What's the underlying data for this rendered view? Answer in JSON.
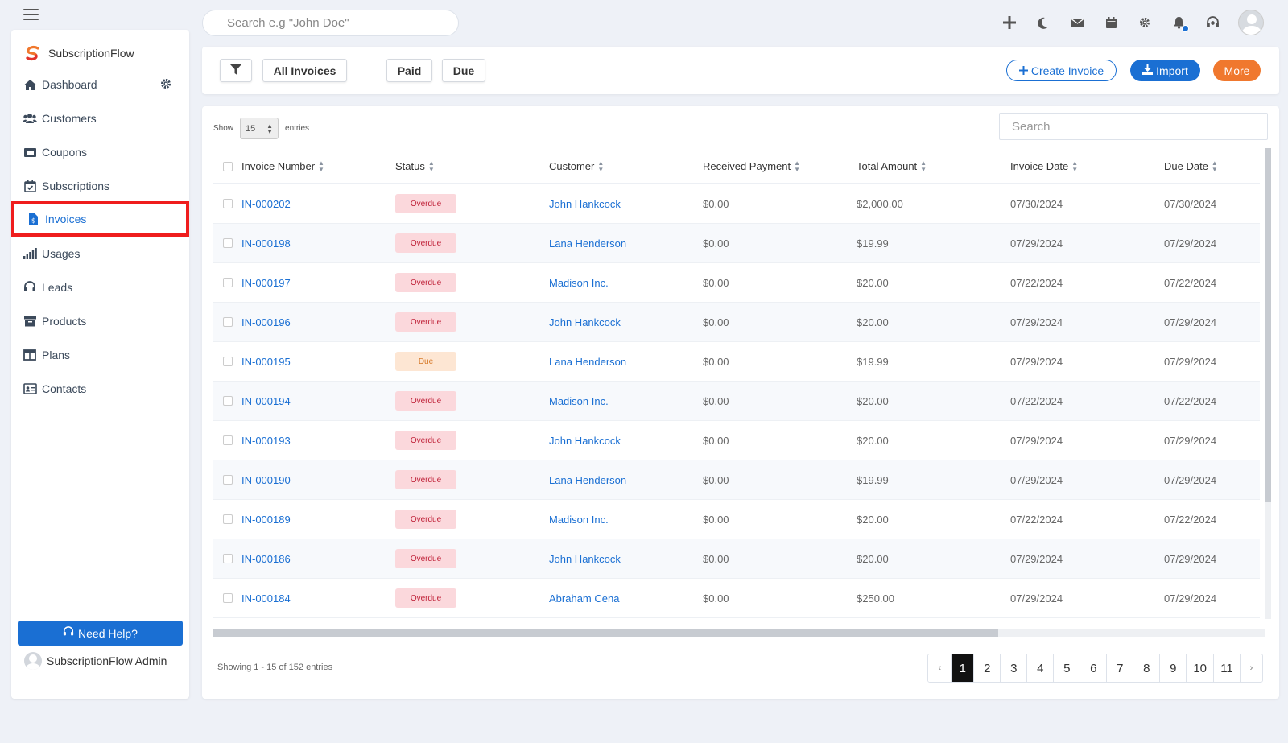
{
  "topbar": {
    "search_placeholder": "Search e.g \"John Doe\""
  },
  "sidebar": {
    "brand": "SubscriptionFlow",
    "items": [
      {
        "label": "Dashboard",
        "icon": "home-icon"
      },
      {
        "label": "Customers",
        "icon": "users-icon"
      },
      {
        "label": "Coupons",
        "icon": "ticket-icon"
      },
      {
        "label": "Subscriptions",
        "icon": "calendar-check-icon"
      },
      {
        "label": "Invoices",
        "icon": "file-invoice-icon"
      },
      {
        "label": "Usages",
        "icon": "signal-bars-icon"
      },
      {
        "label": "Leads",
        "icon": "headset-icon"
      },
      {
        "label": "Products",
        "icon": "archive-box-icon"
      },
      {
        "label": "Plans",
        "icon": "columns-icon"
      },
      {
        "label": "Contacts",
        "icon": "address-card-icon"
      }
    ],
    "help_label": "Need Help?",
    "admin_name": "SubscriptionFlow Admin"
  },
  "toolbar": {
    "all_invoices": "All Invoices",
    "paid": "Paid",
    "due": "Due",
    "create_invoice": "Create Invoice",
    "import": "Import",
    "more": "More"
  },
  "colors": {
    "primary": "#1a6fd3",
    "accent_orange": "#f0782e",
    "highlight_red": "#ef1d1d",
    "overdue_bg": "#fbd8dc",
    "due_bg": "#fde6d3"
  },
  "table": {
    "show_label": "Show",
    "entries_value": "15",
    "entries_label": "entries",
    "search_placeholder": "Search",
    "headers": [
      "Invoice Number",
      "Status",
      "Customer",
      "Received Payment",
      "Total Amount",
      "Invoice Date",
      "Due Date"
    ],
    "rows": [
      {
        "num": "IN-000202",
        "status": "Overdue",
        "customer": "John Hankcock",
        "received": "$0.00",
        "total": "$2,000.00",
        "invoice_date": "07/30/2024",
        "due_date": "07/30/2024"
      },
      {
        "num": "IN-000198",
        "status": "Overdue",
        "customer": "Lana Henderson",
        "received": "$0.00",
        "total": "$19.99",
        "invoice_date": "07/29/2024",
        "due_date": "07/29/2024"
      },
      {
        "num": "IN-000197",
        "status": "Overdue",
        "customer": "Madison Inc.",
        "received": "$0.00",
        "total": "$20.00",
        "invoice_date": "07/22/2024",
        "due_date": "07/22/2024"
      },
      {
        "num": "IN-000196",
        "status": "Overdue",
        "customer": "John Hankcock",
        "received": "$0.00",
        "total": "$20.00",
        "invoice_date": "07/29/2024",
        "due_date": "07/29/2024"
      },
      {
        "num": "IN-000195",
        "status": "Due",
        "customer": "Lana Henderson",
        "received": "$0.00",
        "total": "$19.99",
        "invoice_date": "07/29/2024",
        "due_date": "07/29/2024"
      },
      {
        "num": "IN-000194",
        "status": "Overdue",
        "customer": "Madison Inc.",
        "received": "$0.00",
        "total": "$20.00",
        "invoice_date": "07/22/2024",
        "due_date": "07/22/2024"
      },
      {
        "num": "IN-000193",
        "status": "Overdue",
        "customer": "John Hankcock",
        "received": "$0.00",
        "total": "$20.00",
        "invoice_date": "07/29/2024",
        "due_date": "07/29/2024"
      },
      {
        "num": "IN-000190",
        "status": "Overdue",
        "customer": "Lana Henderson",
        "received": "$0.00",
        "total": "$19.99",
        "invoice_date": "07/29/2024",
        "due_date": "07/29/2024"
      },
      {
        "num": "IN-000189",
        "status": "Overdue",
        "customer": "Madison Inc.",
        "received": "$0.00",
        "total": "$20.00",
        "invoice_date": "07/22/2024",
        "due_date": "07/22/2024"
      },
      {
        "num": "IN-000186",
        "status": "Overdue",
        "customer": "John Hankcock",
        "received": "$0.00",
        "total": "$20.00",
        "invoice_date": "07/29/2024",
        "due_date": "07/29/2024"
      },
      {
        "num": "IN-000184",
        "status": "Overdue",
        "customer": "Abraham Cena",
        "received": "$0.00",
        "total": "$250.00",
        "invoice_date": "07/29/2024",
        "due_date": "07/29/2024"
      }
    ],
    "showing_text": "Showing 1 - 15 of 152 entries"
  },
  "pagination": {
    "prev": "‹",
    "next": "›",
    "pages": [
      "1",
      "2",
      "3",
      "4",
      "5",
      "6",
      "7",
      "8",
      "9",
      "10",
      "11"
    ],
    "current": "1"
  }
}
